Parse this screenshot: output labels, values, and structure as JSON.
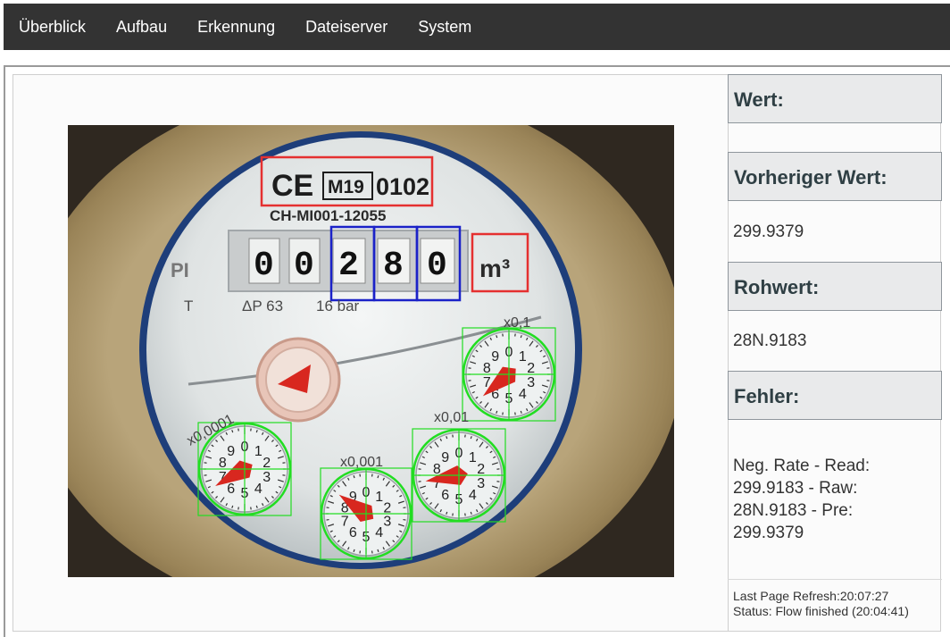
{
  "nav": {
    "items": [
      "Überblick",
      "Aufbau",
      "Erkennung",
      "Dateiserver",
      "System"
    ]
  },
  "meter_image": {
    "ce_mark": "CE",
    "class_mark": "M19",
    "notified_body": "0102",
    "serial": "CH-MI001-12055",
    "brand_fragment": "PI",
    "digits": [
      "0",
      "0",
      "2",
      "8",
      "0"
    ],
    "unit": "m³",
    "spec_t": "T",
    "spec_dp": "ΔP 63",
    "spec_pressure": "16 bar",
    "dial_factors": [
      "x0,1",
      "x0,01",
      "x0,001",
      "x0,0001"
    ],
    "dial_numbers": [
      "0",
      "1",
      "2",
      "3",
      "4",
      "5",
      "6",
      "7",
      "8",
      "9"
    ],
    "colors": {
      "roi_red": "#e53030",
      "roi_blue": "#1b22c8",
      "roi_green": "#22dd22",
      "pointer_red": "#d8271f"
    }
  },
  "panel": {
    "value_label": "Wert:",
    "value": "",
    "previous_label": "Vorheriger Wert:",
    "previous_value": "299.9379",
    "raw_label": "Rohwert:",
    "raw_value": "28N.9183",
    "error_label": "Fehler:",
    "error_lines": [
      "Neg. Rate - Read:",
      "299.9183 - Raw:",
      "28N.9183 - Pre:",
      "299.9379"
    ],
    "last_refresh": "Last Page Refresh:20:07:27",
    "status": "Status: Flow finished (20:04:41)"
  }
}
